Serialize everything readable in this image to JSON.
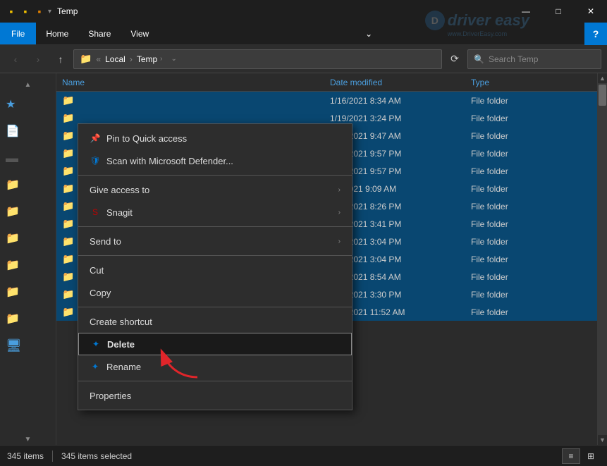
{
  "titleBar": {
    "title": "Temp",
    "icons": [
      "🟨",
      "🟧",
      "🟫"
    ],
    "minimizeLabel": "—",
    "restoreLabel": "□",
    "closeLabel": "✕"
  },
  "menuBar": {
    "fileLabel": "File",
    "homeLabel": "Home",
    "shareLabel": "Share",
    "viewLabel": "View",
    "chevronLabel": "⌄",
    "helpLabel": "?"
  },
  "navBar": {
    "backDisabled": true,
    "forwardDisabled": true,
    "upLabel": "↑",
    "addressParts": [
      "Local",
      "Temp"
    ],
    "searchPlaceholder": "Search Temp",
    "refreshLabel": "⟳"
  },
  "columns": {
    "nameLabel": "Name",
    "dateLabel": "Date modified",
    "typeLabel": "Type"
  },
  "files": [
    {
      "name": "",
      "date": "1/16/2021 8:34 AM",
      "type": "File folder"
    },
    {
      "name": "",
      "date": "1/19/2021 3:24 PM",
      "type": "File folder"
    },
    {
      "name": "",
      "date": "1/15/2021 9:47 AM",
      "type": "File folder"
    },
    {
      "name": "",
      "date": "1/13/2021 9:57 PM",
      "type": "File folder"
    },
    {
      "name": "",
      "date": "1/13/2021 9:57 PM",
      "type": "File folder"
    },
    {
      "name": "",
      "date": "1/6/2021 9:09 AM",
      "type": "File folder"
    },
    {
      "name": "",
      "date": "1/15/2021 8:26 PM",
      "type": "File folder"
    },
    {
      "name": "",
      "date": "1/22/2021 3:41 PM",
      "type": "File folder"
    },
    {
      "name": "",
      "date": "1/15/2021 3:04 PM",
      "type": "File folder"
    },
    {
      "name": "",
      "date": "1/15/2021 3:04 PM",
      "type": "File folder"
    },
    {
      "name": "",
      "date": "1/23/2021 8:54 AM",
      "type": "File folder"
    },
    {
      "name": "",
      "date": "1/22/2021 3:30 PM",
      "type": "File folder"
    },
    {
      "name": "",
      "date": "1/12/2021 11:52 AM",
      "type": "File folder"
    }
  ],
  "contextMenu": {
    "pinLabel": "Pin to Quick access",
    "scanLabel": "Scan with Microsoft Defender...",
    "giveAccessLabel": "Give access to",
    "snagitLabel": "Snagit",
    "sendToLabel": "Send to",
    "cutLabel": "Cut",
    "copyLabel": "Copy",
    "createShortcutLabel": "Create shortcut",
    "deleteLabel": "Delete",
    "renameLabel": "Rename",
    "propertiesLabel": "Properties"
  },
  "statusBar": {
    "itemCount": "345 items",
    "selectedCount": "345 items selected",
    "divider": "|"
  },
  "watermark": {
    "brand": "driver easy",
    "sub": "www.DriverEasy.com"
  }
}
